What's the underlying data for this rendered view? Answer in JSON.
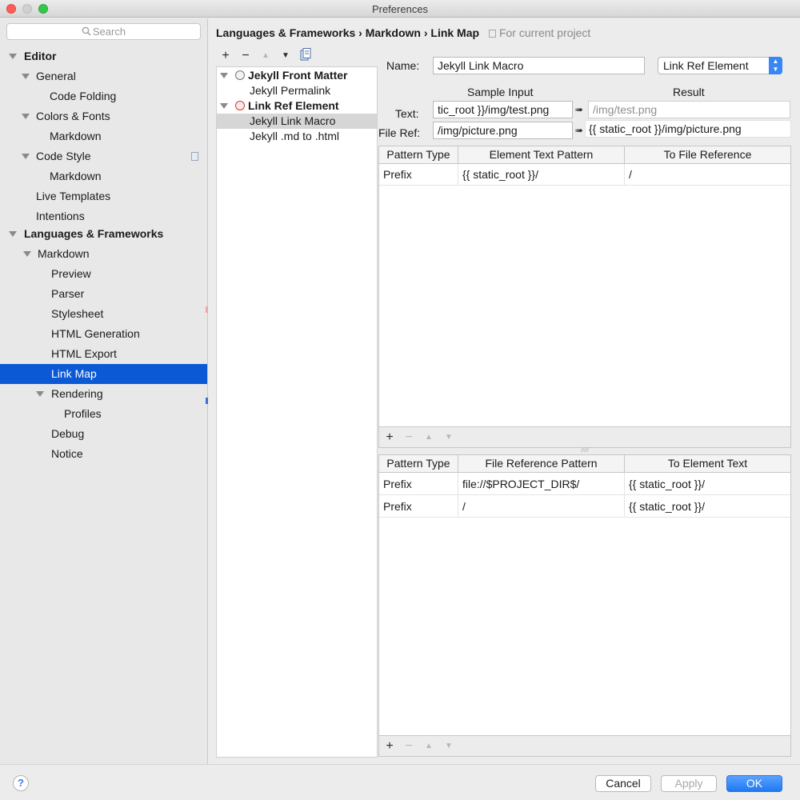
{
  "window": {
    "title": "Preferences"
  },
  "sidebar": {
    "search_placeholder": "Search",
    "items": [
      {
        "label": "Editor",
        "bold": true,
        "expanded": true
      },
      {
        "label": "General",
        "expanded": true
      },
      {
        "label": "Code Folding"
      },
      {
        "label": "Colors & Fonts",
        "expanded": true
      },
      {
        "label": "Markdown"
      },
      {
        "label": "Code Style",
        "expanded": true
      },
      {
        "label": "Markdown"
      },
      {
        "label": "Live Templates"
      },
      {
        "label": "Intentions"
      },
      {
        "label": "Languages & Frameworks",
        "bold": true,
        "expanded": true
      },
      {
        "label": "Markdown",
        "expanded": true
      },
      {
        "label": "Preview"
      },
      {
        "label": "Parser"
      },
      {
        "label": "Stylesheet"
      },
      {
        "label": "HTML Generation"
      },
      {
        "label": "HTML Export"
      },
      {
        "label": "Link Map",
        "selected": true
      },
      {
        "label": "Rendering",
        "expanded": true
      },
      {
        "label": "Profiles"
      },
      {
        "label": "Debug"
      },
      {
        "label": "Notice"
      }
    ]
  },
  "breadcrumb": {
    "path": "Languages & Frameworks › Markdown › Link Map",
    "scope": "For current project"
  },
  "toolbar": {
    "add": "+",
    "remove": "−",
    "up": "▲",
    "down": "▼"
  },
  "profiles": [
    {
      "label": "Jekyll Front Matter",
      "group": true
    },
    {
      "label": "Jekyll Permalink"
    },
    {
      "label": "Link Ref Element",
      "group": true
    },
    {
      "label": "Jekyll Link Macro",
      "selected": true
    },
    {
      "label": "Jekyll .md to .html"
    }
  ],
  "form": {
    "name_label": "Name:",
    "name_value": "Jekyll Link Macro",
    "type_value": "Link Ref Element",
    "sample_input_label": "Sample Input",
    "result_label": "Result",
    "text_label": "Text:",
    "text_input": "tic_root }}/img/test.png",
    "text_result": "/img/test.png",
    "fileref_label": "File Ref:",
    "fileref_input": "/img/picture.png",
    "fileref_result": "{{ static_root }}/img/picture.png",
    "arrow": "➠"
  },
  "table1": {
    "headers": [
      "Pattern Type",
      "Element Text Pattern",
      "To File Reference"
    ],
    "rows": [
      [
        "Prefix",
        "{{ static_root }}/",
        "/"
      ]
    ]
  },
  "table2": {
    "headers": [
      "Pattern Type",
      "File Reference Pattern",
      "To Element Text"
    ],
    "rows": [
      [
        "Prefix",
        "file://$PROJECT_DIR$/",
        "{{ static_root }}/"
      ],
      [
        "Prefix",
        "/",
        "{{ static_root }}/"
      ]
    ]
  },
  "table_toolbar": {
    "add": "+",
    "remove": "−",
    "up": "▲",
    "down": "▼"
  },
  "buttons": {
    "help": "?",
    "cancel": "Cancel",
    "apply": "Apply",
    "ok": "OK"
  },
  "colors": {
    "selection": "#0c59d6",
    "ok_button": "#1f79f2"
  }
}
